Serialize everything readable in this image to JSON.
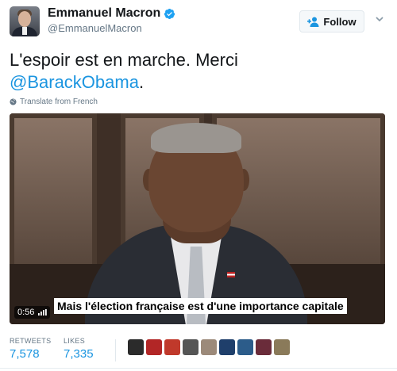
{
  "author": {
    "display_name": "Emmanuel Macron",
    "handle": "@EmmanuelMacron",
    "verified": true,
    "avatar_icon": "user-avatar"
  },
  "follow_button": {
    "label": "Follow",
    "icon": "add-user-icon"
  },
  "menu_icon": "chevron-down-icon",
  "tweet": {
    "text_line1": "L'espoir est en marche. Merci",
    "mention": "@BarackObama",
    "text_end": ".",
    "translate_label": "Translate from French"
  },
  "video": {
    "duration": "0:56",
    "subtitle": "Mais l'élection française est d'une importance capitale"
  },
  "stats": {
    "retweets_label": "RETWEETS",
    "retweets_value": "7,578",
    "likes_label": "LIKES",
    "likes_value": "7,335"
  },
  "likers": [
    {
      "color": "#2b2b2b"
    },
    {
      "color": "#b22626"
    },
    {
      "color": "#c0392b"
    },
    {
      "color": "#555555"
    },
    {
      "color": "#9c8a7a"
    },
    {
      "color": "#1f3f6b"
    },
    {
      "color": "#2c5c8a"
    },
    {
      "color": "#6a2c3a"
    },
    {
      "color": "#8a7a5a"
    }
  ],
  "colors": {
    "accent": "#1b95e0",
    "text": "#14171a",
    "secondary_text": "#657786"
  }
}
